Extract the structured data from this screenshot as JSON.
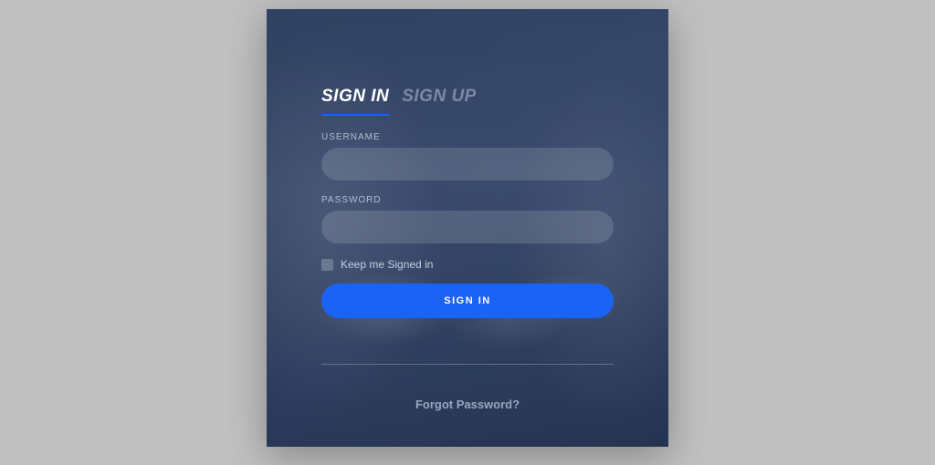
{
  "tabs": {
    "signin": "SIGN IN",
    "signup": "SIGN UP"
  },
  "form": {
    "username_label": "USERNAME",
    "username_value": "",
    "password_label": "PASSWORD",
    "password_value": "",
    "remember_label": "Keep me Signed in",
    "submit_label": "SIGN IN"
  },
  "footer": {
    "forgot_label": "Forgot Password?"
  },
  "colors": {
    "accent": "#1b63f5",
    "background": "#2a3b5c"
  }
}
